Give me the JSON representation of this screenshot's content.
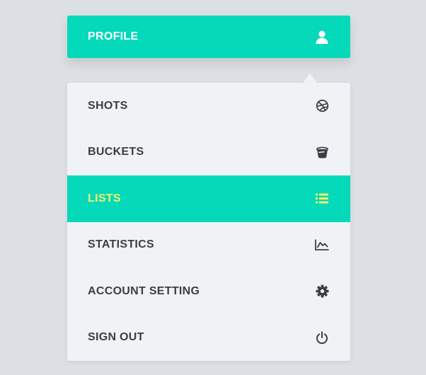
{
  "colors": {
    "accent": "#04d9b9",
    "active_text": "#f4f26b",
    "menu_bg": "#eff3f5",
    "text": "#3b3f44",
    "page_bg": "#dcdfe3"
  },
  "profile": {
    "label": "PROFILE",
    "icon": "user-icon"
  },
  "menu": {
    "active_index": 2,
    "items": [
      {
        "label": "SHOTS",
        "icon": "dribbble-ball-icon"
      },
      {
        "label": "BUCKETS",
        "icon": "bucket-icon"
      },
      {
        "label": "LISTS",
        "icon": "list-icon"
      },
      {
        "label": "STATISTICS",
        "icon": "line-chart-icon"
      },
      {
        "label": "ACCOUNT SETTING",
        "icon": "gear-icon"
      },
      {
        "label": "SIGN OUT",
        "icon": "power-icon"
      }
    ]
  }
}
